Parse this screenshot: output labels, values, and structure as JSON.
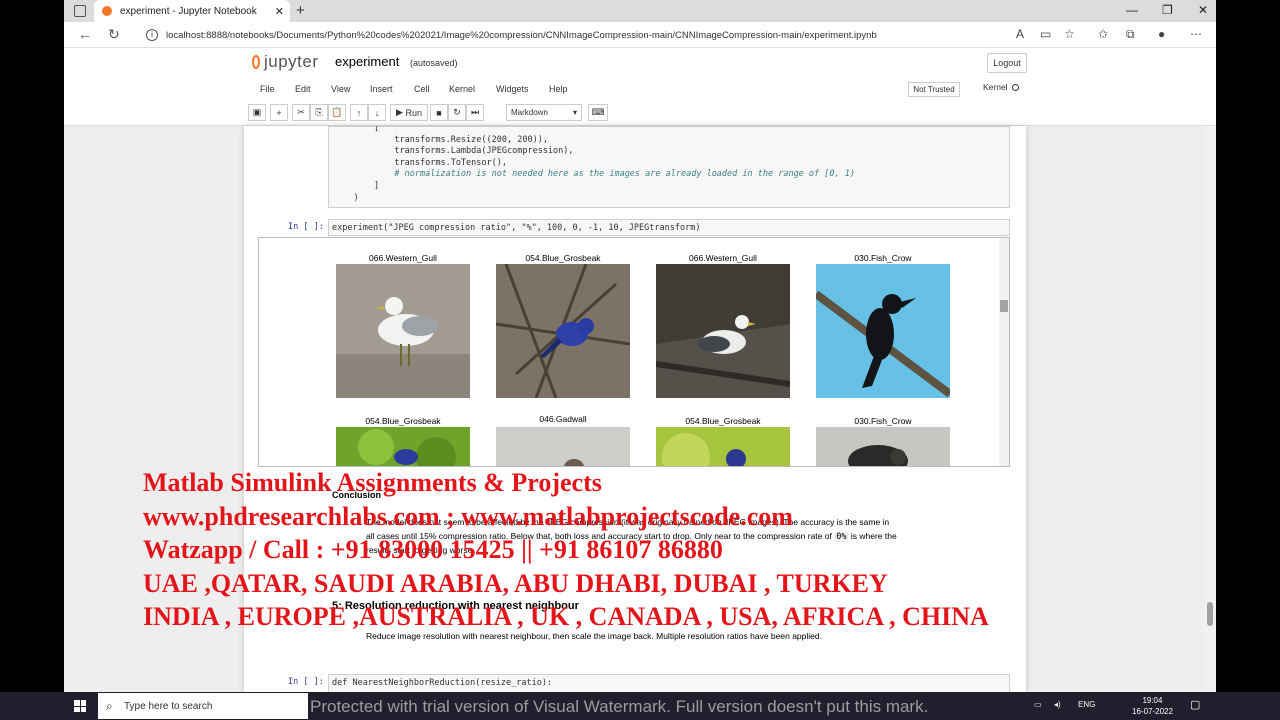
{
  "browser": {
    "tab_title": "experiment - Jupyter Notebook",
    "url": "localhost:8888/notebooks/Documents/Python%20codes%202021/Image%20compression/CNNImageCompression-main/CNNImageCompression-main/experiment.ipynb"
  },
  "jupyter": {
    "logo": "jupyter",
    "notebook_name": "experiment",
    "autosave": "(autosaved)",
    "logout": "Logout",
    "menu": [
      "File",
      "Edit",
      "View",
      "Insert",
      "Cell",
      "Kernel",
      "Widgets",
      "Help"
    ],
    "trust": "Not Trusted",
    "kernel": "Kernel",
    "run_label": "Run",
    "cell_type": "Markdown"
  },
  "cells": {
    "code1_lines": [
      "        [",
      "            transforms.Resize((200, 200)),",
      "            transforms.Lambda(JPEGcompression),",
      "            transforms.ToTensor(),",
      "            # normalization is not needed here as the images are already loaded in the range of [0, 1)",
      "        ]",
      "    )"
    ],
    "prompt": "In [ ]:",
    "code2": "experiment(\"JPEG compression ratio\", \"%\", 100, 0, -1, 10, JPEGtransform)",
    "output_titles": [
      "066.Western_Gull",
      "054.Blue_Grosbeak",
      "066.Western_Gull",
      "030.Fish_Crow",
      "054.Blue_Grosbeak",
      "046.Gadwall",
      "054.Blue_Grosbeak",
      "030.Fish_Crow"
    ],
    "conclusion_heading": "Conclusion",
    "conclusion_text_1": "The model does not seem to be affected by the JPEG compression (it was originally trained on JPEG images). The accuracy is the same in",
    "conclusion_text_2": "all cases until 15% compression ratio. Below that, both loss and accuracy start to drop. Only near to the compression rate of",
    "conclusion_code": "0%",
    "conclusion_text_2b": "is where the",
    "conclusion_text_3": "results start to getting worse.",
    "section_heading": "5: Resolution reduction with nearest neighbour",
    "section_text": "Reduce image resolution with nearest neighbour, then scale the image back. Multiple resolution ratios have been applied.",
    "code3": "def NearestNeighborReduction(resize_ratio):"
  },
  "watermark": {
    "lines": [
      "Matlab Simulink Assignments & Projects",
      "www.phdresearchlabs.com ; www.matlabprojectscode.com",
      "Watzapp / Call : +91 83000 15425 || +91 86107 86880",
      "UAE ,QATAR, SAUDI ARABIA, ABU DHABI, DUBAI , TURKEY",
      "INDIA , EUROPE ,AUSTRALIA , UK , CANADA , USA, AFRICA , CHINA"
    ],
    "color": "#e3151a"
  },
  "taskbar": {
    "search_placeholder": "Type here to search",
    "trial_notice": "Protected with trial version of Visual Watermark. Full version doesn't put this mark.",
    "lang": "ENG",
    "time": "19:04",
    "date": "16-07-2022"
  }
}
